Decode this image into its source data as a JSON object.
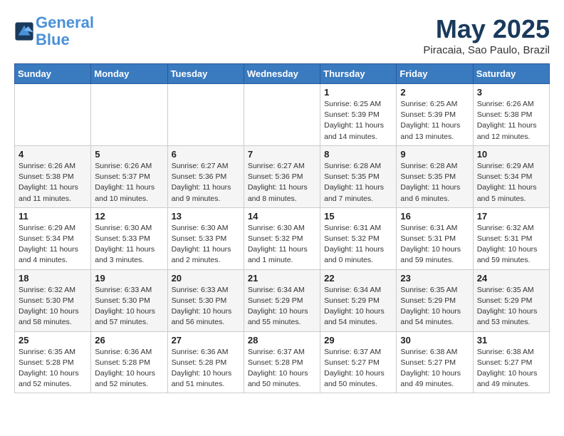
{
  "header": {
    "logo_line1": "General",
    "logo_line2": "Blue",
    "month_title": "May 2025",
    "location": "Piracaia, Sao Paulo, Brazil"
  },
  "weekdays": [
    "Sunday",
    "Monday",
    "Tuesday",
    "Wednesday",
    "Thursday",
    "Friday",
    "Saturday"
  ],
  "weeks": [
    [
      {
        "day": "",
        "info": ""
      },
      {
        "day": "",
        "info": ""
      },
      {
        "day": "",
        "info": ""
      },
      {
        "day": "",
        "info": ""
      },
      {
        "day": "1",
        "info": "Sunrise: 6:25 AM\nSunset: 5:39 PM\nDaylight: 11 hours and 14 minutes."
      },
      {
        "day": "2",
        "info": "Sunrise: 6:25 AM\nSunset: 5:39 PM\nDaylight: 11 hours and 13 minutes."
      },
      {
        "day": "3",
        "info": "Sunrise: 6:26 AM\nSunset: 5:38 PM\nDaylight: 11 hours and 12 minutes."
      }
    ],
    [
      {
        "day": "4",
        "info": "Sunrise: 6:26 AM\nSunset: 5:38 PM\nDaylight: 11 hours and 11 minutes."
      },
      {
        "day": "5",
        "info": "Sunrise: 6:26 AM\nSunset: 5:37 PM\nDaylight: 11 hours and 10 minutes."
      },
      {
        "day": "6",
        "info": "Sunrise: 6:27 AM\nSunset: 5:36 PM\nDaylight: 11 hours and 9 minutes."
      },
      {
        "day": "7",
        "info": "Sunrise: 6:27 AM\nSunset: 5:36 PM\nDaylight: 11 hours and 8 minutes."
      },
      {
        "day": "8",
        "info": "Sunrise: 6:28 AM\nSunset: 5:35 PM\nDaylight: 11 hours and 7 minutes."
      },
      {
        "day": "9",
        "info": "Sunrise: 6:28 AM\nSunset: 5:35 PM\nDaylight: 11 hours and 6 minutes."
      },
      {
        "day": "10",
        "info": "Sunrise: 6:29 AM\nSunset: 5:34 PM\nDaylight: 11 hours and 5 minutes."
      }
    ],
    [
      {
        "day": "11",
        "info": "Sunrise: 6:29 AM\nSunset: 5:34 PM\nDaylight: 11 hours and 4 minutes."
      },
      {
        "day": "12",
        "info": "Sunrise: 6:30 AM\nSunset: 5:33 PM\nDaylight: 11 hours and 3 minutes."
      },
      {
        "day": "13",
        "info": "Sunrise: 6:30 AM\nSunset: 5:33 PM\nDaylight: 11 hours and 2 minutes."
      },
      {
        "day": "14",
        "info": "Sunrise: 6:30 AM\nSunset: 5:32 PM\nDaylight: 11 hours and 1 minute."
      },
      {
        "day": "15",
        "info": "Sunrise: 6:31 AM\nSunset: 5:32 PM\nDaylight: 11 hours and 0 minutes."
      },
      {
        "day": "16",
        "info": "Sunrise: 6:31 AM\nSunset: 5:31 PM\nDaylight: 10 hours and 59 minutes."
      },
      {
        "day": "17",
        "info": "Sunrise: 6:32 AM\nSunset: 5:31 PM\nDaylight: 10 hours and 59 minutes."
      }
    ],
    [
      {
        "day": "18",
        "info": "Sunrise: 6:32 AM\nSunset: 5:30 PM\nDaylight: 10 hours and 58 minutes."
      },
      {
        "day": "19",
        "info": "Sunrise: 6:33 AM\nSunset: 5:30 PM\nDaylight: 10 hours and 57 minutes."
      },
      {
        "day": "20",
        "info": "Sunrise: 6:33 AM\nSunset: 5:30 PM\nDaylight: 10 hours and 56 minutes."
      },
      {
        "day": "21",
        "info": "Sunrise: 6:34 AM\nSunset: 5:29 PM\nDaylight: 10 hours and 55 minutes."
      },
      {
        "day": "22",
        "info": "Sunrise: 6:34 AM\nSunset: 5:29 PM\nDaylight: 10 hours and 54 minutes."
      },
      {
        "day": "23",
        "info": "Sunrise: 6:35 AM\nSunset: 5:29 PM\nDaylight: 10 hours and 54 minutes."
      },
      {
        "day": "24",
        "info": "Sunrise: 6:35 AM\nSunset: 5:29 PM\nDaylight: 10 hours and 53 minutes."
      }
    ],
    [
      {
        "day": "25",
        "info": "Sunrise: 6:35 AM\nSunset: 5:28 PM\nDaylight: 10 hours and 52 minutes."
      },
      {
        "day": "26",
        "info": "Sunrise: 6:36 AM\nSunset: 5:28 PM\nDaylight: 10 hours and 52 minutes."
      },
      {
        "day": "27",
        "info": "Sunrise: 6:36 AM\nSunset: 5:28 PM\nDaylight: 10 hours and 51 minutes."
      },
      {
        "day": "28",
        "info": "Sunrise: 6:37 AM\nSunset: 5:28 PM\nDaylight: 10 hours and 50 minutes."
      },
      {
        "day": "29",
        "info": "Sunrise: 6:37 AM\nSunset: 5:27 PM\nDaylight: 10 hours and 50 minutes."
      },
      {
        "day": "30",
        "info": "Sunrise: 6:38 AM\nSunset: 5:27 PM\nDaylight: 10 hours and 49 minutes."
      },
      {
        "day": "31",
        "info": "Sunrise: 6:38 AM\nSunset: 5:27 PM\nDaylight: 10 hours and 49 minutes."
      }
    ]
  ]
}
